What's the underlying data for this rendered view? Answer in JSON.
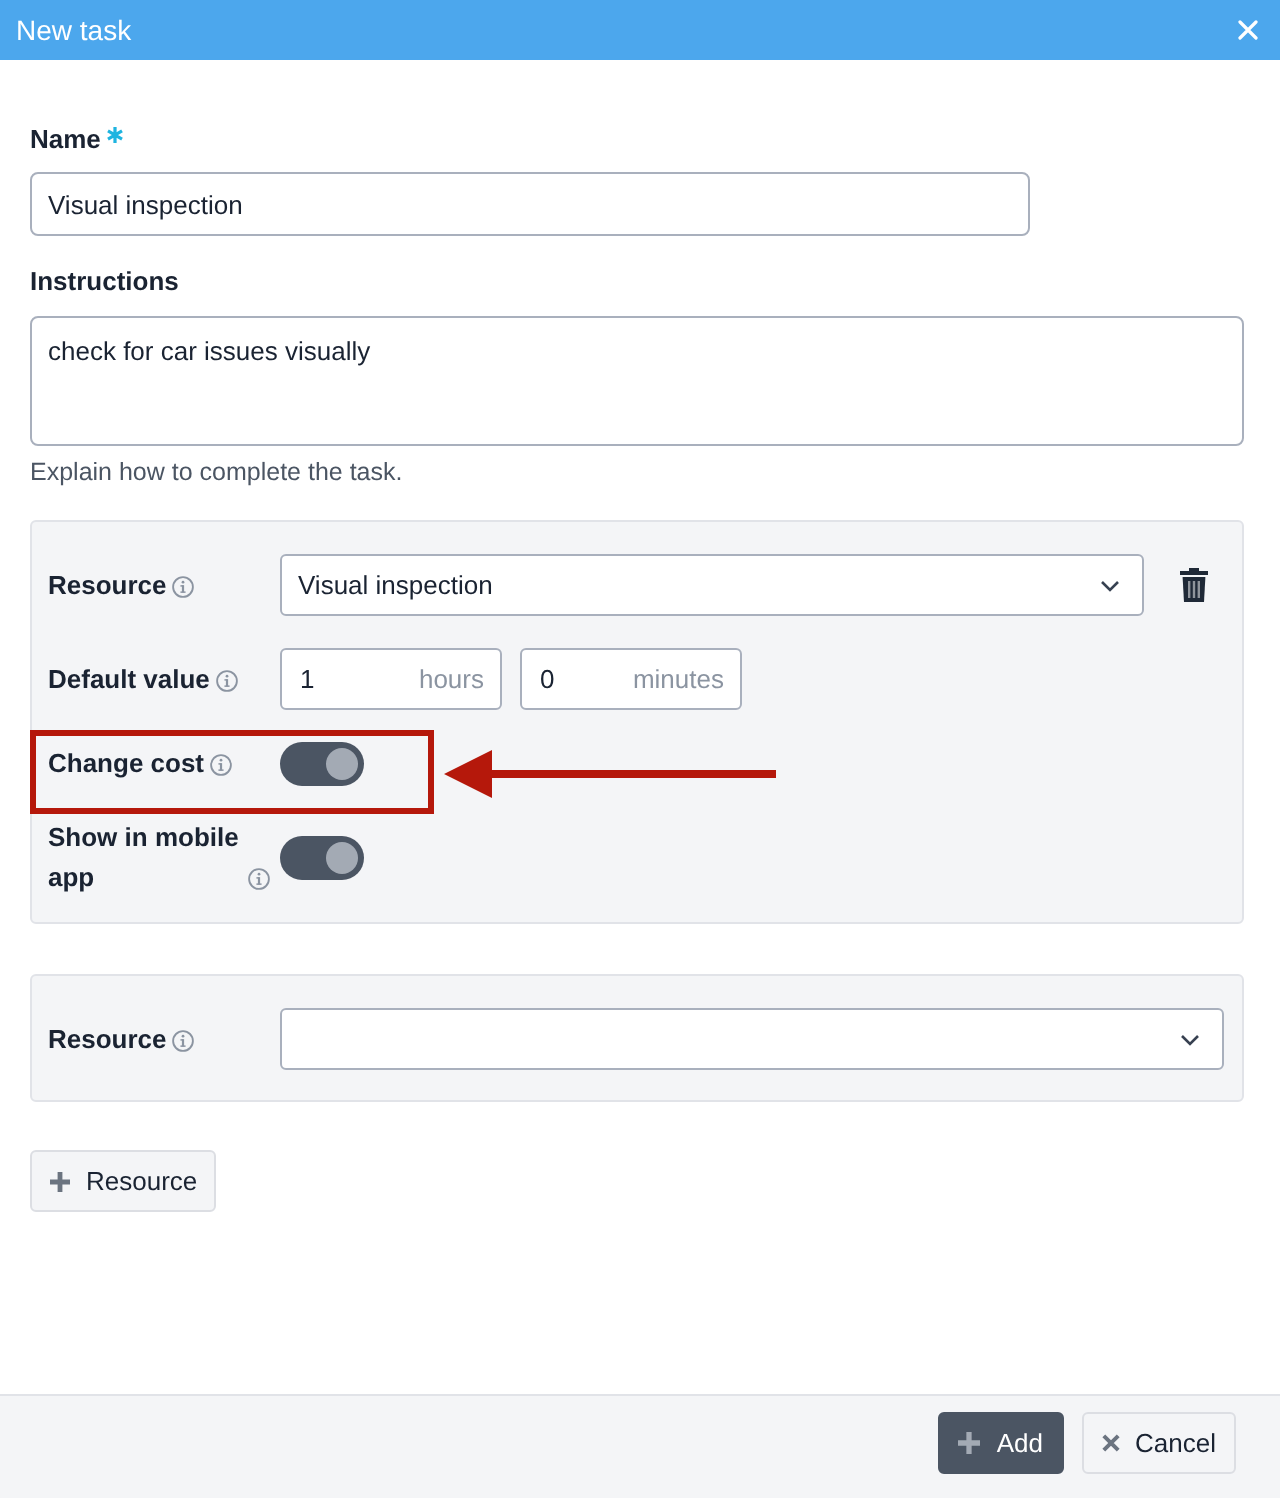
{
  "dialog": {
    "title": "New task"
  },
  "name_field": {
    "label": "Name",
    "required": true,
    "value": "Visual inspection"
  },
  "instructions_field": {
    "label": "Instructions",
    "value": "check for car issues visually",
    "help": "Explain how to complete the task."
  },
  "resources": [
    {
      "rows": [
        {
          "kind": "select",
          "label": "Resource",
          "value": "Visual inspection",
          "deletable": true
        },
        {
          "kind": "duration",
          "label": "Default value",
          "inputs": [
            {
              "value": "1",
              "unit": "hours"
            },
            {
              "value": "0",
              "unit": "minutes"
            }
          ]
        },
        {
          "kind": "toggle",
          "label": "Change cost",
          "on": true,
          "highlighted": true
        },
        {
          "kind": "toggle",
          "label": "Show in mobile app",
          "on": true,
          "highlighted": false
        }
      ]
    },
    {
      "rows": [
        {
          "kind": "select",
          "label": "Resource",
          "deletable": false
        }
      ]
    }
  ],
  "add_resource_button": {
    "label": "Resource"
  },
  "footer": {
    "buttons": [
      {
        "kind": "add",
        "label": "Add"
      },
      {
        "kind": "cancel",
        "label": "Cancel"
      }
    ]
  }
}
